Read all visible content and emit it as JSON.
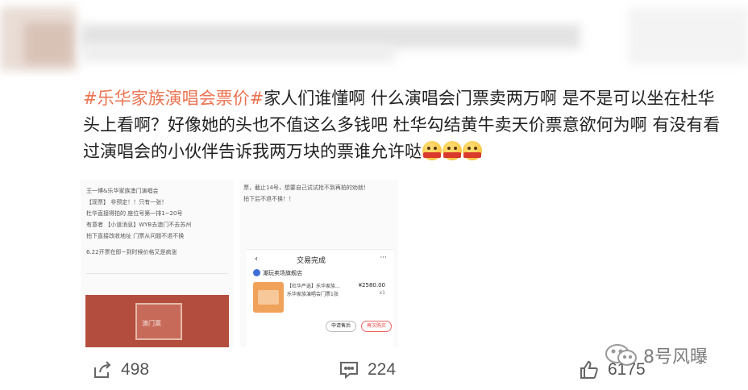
{
  "post": {
    "hashtag": "#乐华家族演唱会票价#",
    "text": "家人们谁懂啊 什么演唱会门票卖两万啊 是不是可以坐在杜华头上看啊？好像她的头也不值这么多钱吧 杜华勾结黄牛卖天价票意欲何为啊 有没有看过演唱会的小伙伴告诉我两万块的票谁允许哒",
    "emojis": [
      "crying-face",
      "crying-face",
      "crying-face"
    ]
  },
  "image_left": {
    "lines": [
      "王一博&乐华家族澳门演唱会",
      "【现票】 非预定！！只有一张！",
      "杜华直接得拍的 座位号第一排1~20号",
      "有意者 【小道消息】WYB去澳门不去苏州",
      "拍下直接改收地址 门票从问题不退不换",
      "6.22开票在即~到时候价格又是疯涨"
    ],
    "ticket_text": "澳门票"
  },
  "image_right": {
    "lines": [
      "票，截止14号，想要自己试试抢不到再拍的劝就！",
      "拍下后不退不换！！"
    ],
    "phone": {
      "back": "‹",
      "title": "交易完成",
      "more": "···",
      "store": "潮玩卖场旗舰店",
      "desc1": "【杜华严选】乐华家族...",
      "desc2": "乐华家族演唱会门票1张",
      "price": "¥2580.00",
      "qty": "x1",
      "btn_a": "申请售后",
      "btn_b": "再次购买"
    }
  },
  "actions": {
    "share_count": "498",
    "comment_count": "224",
    "like_count": "6175"
  },
  "watermark": {
    "text": "8号风曝"
  }
}
